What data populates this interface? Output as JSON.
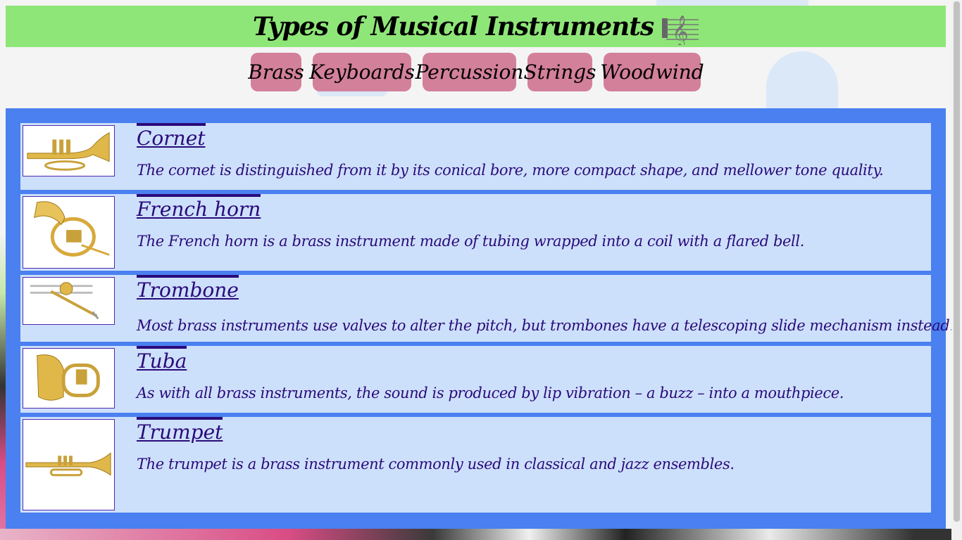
{
  "header": {
    "title": "Types of Musical Instruments",
    "icon": "treble-clef-icon"
  },
  "tabs": [
    {
      "label": "Brass"
    },
    {
      "label": "Keyboards"
    },
    {
      "label": "Percussion"
    },
    {
      "label": "Strings"
    },
    {
      "label": "Woodwind"
    }
  ],
  "instruments": [
    {
      "name": "Cornet",
      "description": "The cornet is distinguished from it by its conical bore, more compact shape, and mellower tone quality.",
      "icon": "cornet-icon"
    },
    {
      "name": "French horn",
      "description": "The French horn is a brass instrument made of tubing wrapped into a coil with a flared bell.",
      "icon": "french-horn-icon"
    },
    {
      "name": "Trombone",
      "description": "Most brass instruments use valves to alter the pitch, but trombones have a telescoping slide mechanism instead.",
      "icon": "trombone-icon"
    },
    {
      "name": "Tuba",
      "description": "As with all brass instruments, the sound is produced by lip vibration – a buzz – into a mouthpiece.",
      "icon": "tuba-icon"
    },
    {
      "name": "Trumpet",
      "description": "The trumpet is a brass instrument commonly used in classical and jazz ensembles.",
      "icon": "trumpet-icon"
    }
  ],
  "colors": {
    "header_bg": "#8fe678",
    "tab_bg": "#d3809b",
    "main_bg": "#4a80f0",
    "item_bg": "#cde0fb",
    "text": "#2a0a7a"
  }
}
